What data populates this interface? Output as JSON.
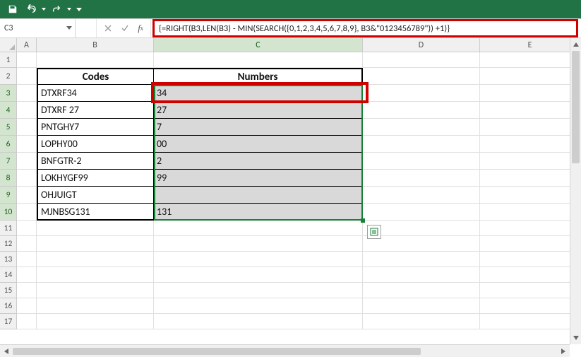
{
  "namebox": {
    "value": "C3"
  },
  "formula": "{=RIGHT(B3,LEN(B3) - MIN(SEARCH({0,1,2,3,4,5,6,7,8,9}, B3&\"0123456789\")) +1)}",
  "columns": [
    "A",
    "B",
    "C",
    "D",
    "E"
  ],
  "row_numbers": [
    1,
    2,
    3,
    4,
    5,
    6,
    7,
    8,
    9,
    10,
    11,
    12,
    13,
    14,
    15,
    16,
    17
  ],
  "headers": {
    "codes": "Codes",
    "numbers": "Numbers"
  },
  "table": [
    {
      "code": "DTXRF34",
      "number": "34"
    },
    {
      "code": "DTXRF 27",
      "number": "27"
    },
    {
      "code": "PNTGHY7",
      "number": "7"
    },
    {
      "code": "LOPHY00",
      "number": "00"
    },
    {
      "code": "BNFGTR-2",
      "number": "2"
    },
    {
      "code": "LOKHYGF99",
      "number": "99"
    },
    {
      "code": "OHJUIGT",
      "number": ""
    },
    {
      "code": "MJNBSG131",
      "number": "131"
    }
  ],
  "selection": {
    "range": "C3:C10",
    "active": "C3"
  },
  "colors": {
    "highlight_red": "#d10000",
    "selection_green": "#1a7f37",
    "fill_gray": "#d9d9d9"
  }
}
